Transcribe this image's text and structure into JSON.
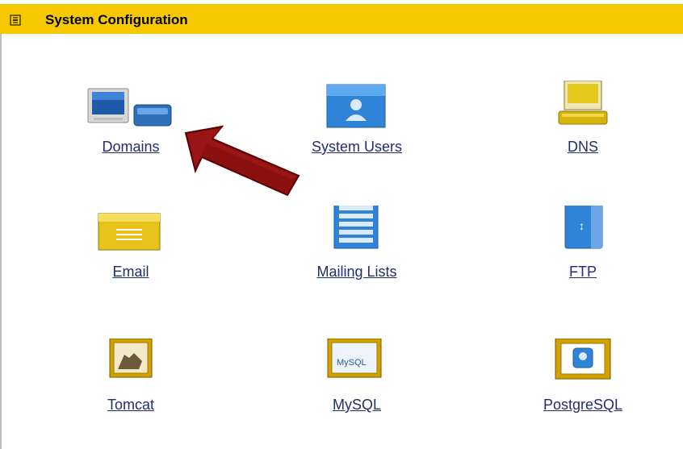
{
  "panel": {
    "title": "System Configuration",
    "items": [
      {
        "label": "Domains",
        "icon": "domains-icon"
      },
      {
        "label": "System Users",
        "icon": "system-users-icon"
      },
      {
        "label": "DNS",
        "icon": "dns-icon"
      },
      {
        "label": "Email",
        "icon": "email-icon"
      },
      {
        "label": "Mailing Lists",
        "icon": "mailing-lists-icon"
      },
      {
        "label": "FTP",
        "icon": "ftp-icon"
      },
      {
        "label": "Tomcat",
        "icon": "tomcat-icon"
      },
      {
        "label": "MySQL",
        "icon": "mysql-icon"
      },
      {
        "label": "PostgreSQL",
        "icon": "postgresql-icon"
      }
    ],
    "mysql_icon_text": "MySQL"
  },
  "colors": {
    "header": "#f6c800",
    "link": "#1f2f6f",
    "arrow": "#8b1010"
  }
}
